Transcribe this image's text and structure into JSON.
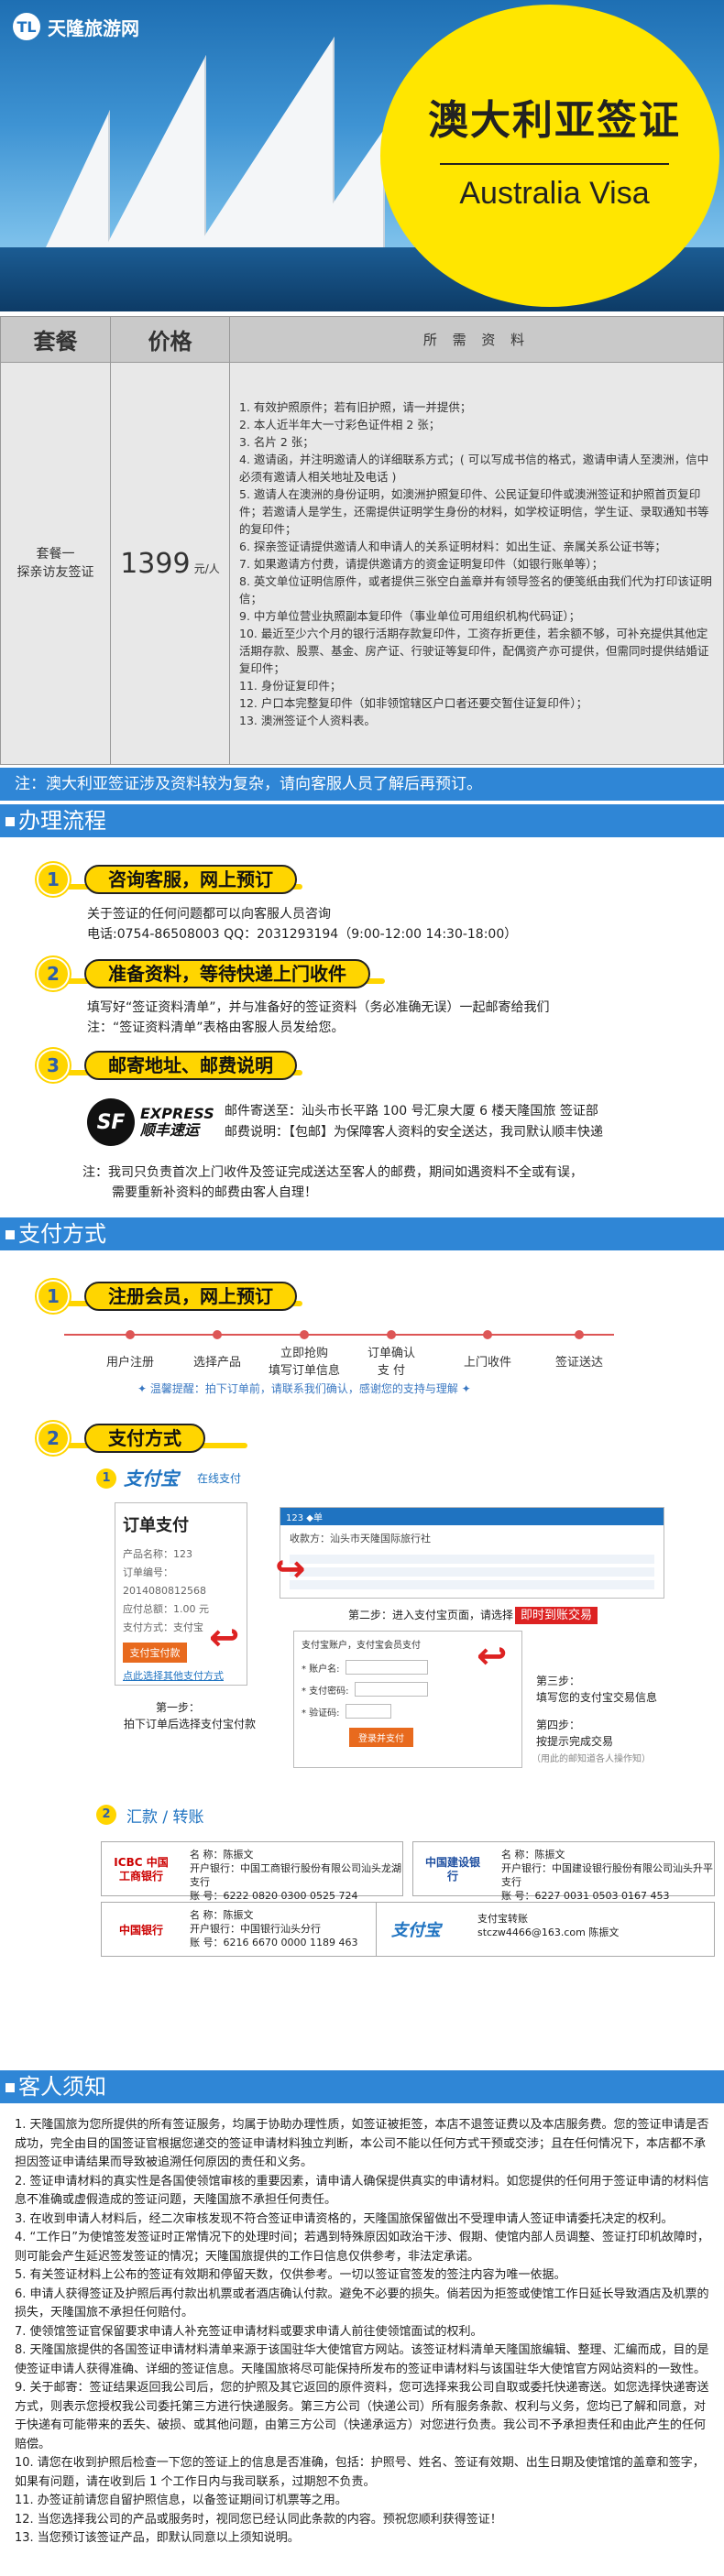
{
  "brand": {
    "name": "天隆旅游网",
    "mark": "TL"
  },
  "hero": {
    "title_cn": "澳大利亚签证",
    "title_en": "Australia Visa"
  },
  "table": {
    "headers": {
      "package": "套餐",
      "price": "价格",
      "requirements": "所 需 资 料"
    },
    "package_name_line1": "套餐一",
    "package_name_line2": "探亲访友签证",
    "price_value": "1399",
    "price_unit": "元/人",
    "requirements": [
      "1. 有效护照原件；若有旧护照，请一并提供；",
      "2. 本人近半年大一寸彩色证件相 2 张；",
      "3. 名片 2 张；",
      "4. 邀请函，并注明邀请人的详细联系方式；( 可以写成书信的格式，邀请申请人至澳洲，信中必须有邀请人相关地址及电话 )",
      "5. 邀请人在澳洲的身份证明，如澳洲护照复印件、公民证复印件或澳洲签证和护照首页复印件；若邀请人是学生，还需提供证明学生身份的材料，如学校证明信，学生证、录取通知书等的复印件；",
      "6. 探亲签证请提供邀请人和申请人的关系证明材料：如出生证、亲属关系公证书等；",
      "7. 如果邀请方付费，请提供邀请方的资金证明复印件（如银行账单等）；",
      "8. 英文单位证明信原件，或者提供三张空白盖章并有领导签名的便笺纸由我们代为打印该证明信；",
      "9. 中方单位营业执照副本复印件（事业单位可用组织机构代码证）；",
      "10. 最近至少六个月的银行活期存款复印件，工资存折更佳，若余额不够，可补充提供其他定活期存款、股票、基金、房产证、行驶证等复印件，配偶资产亦可提供，但需同时提供结婚证复印件；",
      "11. 身份证复印件；",
      "12. 户口本完整复印件（如非领馆辖区户口者还要交暂住证复印件）；",
      "13. 澳洲签证个人资料表。"
    ]
  },
  "note_bar": "注：澳大利亚签证涉及资料较为复杂，请向客服人员了解后再预订。",
  "section_process": {
    "title": "办理流程"
  },
  "process_steps": [
    {
      "num": "1",
      "label": "咨询客服，网上预订"
    },
    {
      "num": "2",
      "label": "准备资料，等待快递上门收件"
    },
    {
      "num": "3",
      "label": "邮寄地址、邮费说明"
    }
  ],
  "process_text": {
    "step1_line1": "关于签证的任何问题都可以向客服人员咨询",
    "step1_line2": "电话:0754-86508003    QQ：2031293194（9:00-12:00  14:30-18:00）",
    "step2_line1": "填写好“签证资料清单”，并与准备好的签证资料（务必准确无误）一起邮寄给我们",
    "step2_line2": "注：“签证资料清单”表格由客服人员发给您。",
    "step3_line1": "邮件寄送至：汕头市长平路 100 号汇泉大厦 6 楼天隆国旅 签证部",
    "step3_line2": "邮费说明：【包邮】为保障客人资料的安全送达，我司默认顺丰快递",
    "note_line1": "注：我司只负责首次上门收件及签证完成送达至客人的邮费，期间如遇资料不全或有误，",
    "note_line2": "需要重新补资料的邮费由客人自理！"
  },
  "sf_logo": {
    "mark": "SF",
    "word1": "EXPRESS",
    "word2": "顺丰速运"
  },
  "section_pay": {
    "title": "支付方式"
  },
  "pay_steps": [
    {
      "num": "1",
      "label": "注册会员，网上预订"
    },
    {
      "num": "2",
      "label": "支付方式"
    }
  ],
  "flow": {
    "steps": [
      "用户注册",
      "选择产品",
      "立即抢购",
      "填写订单信息",
      "订单确认",
      "支 付",
      "上门收件",
      "签证送达"
    ],
    "tip": "✦ 温馨提醒：拍下订单前，请联系我们确认，感谢您的支持与理解 ✦"
  },
  "pay_method": {
    "alipay_num": "1",
    "alipay_logo": "支付宝",
    "alipay_sub": "在线支付",
    "order_title": "订单支付",
    "order_lines": [
      "产品名称：123",
      "订单编号：2014080812568",
      "应付总额：1.00 元",
      "支付方式：支付宝"
    ],
    "pay_button": "支付宝付款",
    "other_link": "点此选择其他支付方式",
    "step1_caption_a": "第一步：",
    "step1_caption_b": "拍下订单后选择支付宝付款",
    "cashier_header": "123 ◆单",
    "cashier_amount": "收款方：汕头市天隆国际旅行社",
    "step2_caption": "第二步：进入支付宝页面，请选择",
    "step2_highlight": "即时到账交易",
    "login_title": "支付宝账户，支付宝会员支付",
    "login_user": "* 账户名:",
    "login_pwd": "* 支付密码:",
    "login_code": "* 验证码:",
    "login_btn": "登录并支付",
    "step3_a": "第三步：",
    "step3_b": "填写您的支付宝交易信息",
    "step4_a": "第四步：",
    "step4_b": "按提示完成交易",
    "step4_c": "（用此的邮知道各人操作知）"
  },
  "remit": {
    "num": "2",
    "title": "汇款 / 转账",
    "banks": [
      {
        "logo": "ICBC 中国工商银行",
        "name": "名    称：陈振文",
        "branch": "开户银行：中国工商银行股份有限公司汕头龙湖支行",
        "acct": "账    号：6222 0820 0300 0525 724"
      },
      {
        "logo": "中国建设银行",
        "name": "名    称：陈振文",
        "branch": "开户银行：中国建设银行股份有限公司汕头升平支行",
        "acct": "账    号：6227 0031 0503 0167 453"
      },
      {
        "logo": "中国银行",
        "name": "名    称：陈振文",
        "branch": "开户银行：中国银行汕头分行",
        "acct": "账    号：6216 6670 0000 1189 463"
      },
      {
        "logo": "支付宝",
        "name": "支付宝转账",
        "branch": "",
        "acct": "stczw4466@163.com  陈振文"
      }
    ]
  },
  "section_notice": {
    "title": "客人须知"
  },
  "notice": [
    "1. 天隆国旅为您所提供的所有签证服务，均属于协助办理性质，如签证被拒签，本店不退签证费以及本店服务费。您的签证申请是否成功，完全由目的国签证官根据您递交的签证申请材料独立判断，本公司不能以任何方式干预或交涉；且在任何情况下，本店都不承担因签证申请结果而导致被追溯任何原因的责任和义务。",
    "2. 签证申请材料的真实性是各国使领馆审核的重要因素，请申请人确保提供真实的申请材料。如您提供的任何用于签证申请的材料信息不准确或虚假造成的签证问题，天隆国旅不承担任何责任。",
    "3. 在收到申请人材料后，经二次审核发现不符合签证申请资格的，天隆国旅保留做出不受理申请人签证申请委托决定的权利。",
    "4. “工作日”为使馆签发签证时正常情况下的处理时间；若遇到特殊原因如政治干涉、假期、使馆内部人员调整、签证打印机故障时，则可能会产生延迟签发签证的情况；天隆国旅提供的工作日信息仅供参考，非法定承诺。",
    "5. 有关签证材料上公布的签证有效期和停留天数，仅供参考。一切以签证官签发的签注内容为唯一依据。",
    "6. 申请人获得签证及护照后再付款出机票或者酒店确认付款。避免不必要的损失。倘若因为拒签或使馆工作日延长导致酒店及机票的损失，天隆国旅不承担任何赔付。",
    "7. 使领馆签证官保留要求申请人补充签证申请材料或要求申请人前往使领馆面试的权利。",
    "8. 天隆国旅提供的各国签证申请材料清单来源于该国驻华大使馆官方网站。该签证材料清单天隆国旅编辑、整理、汇编而成，目的是使签证申请人获得准确、详细的签证信息。天隆国旅将尽可能保持所发布的签证申请材料与该国驻华大使馆官方网站资料的一致性。",
    "9. 关于邮寄：签证结果返回我公司后，您的护照及其它返回的原件资料，您可选择来我公司自取或委托快递寄送。如您选择快递寄送方式，则表示您授权我公司委托第三方进行快递服务。第三方公司（快递公司）所有服务条款、权利与义务，您均已了解和同意，对于快递有可能带来的丢失、破损、或其他问题，由第三方公司（快递承运方）对您进行负责。我公司不予承担责任和由此产生的任何赔偿。",
    "10. 请您在收到护照后检查一下您的签证上的信息是否准确，包括：护照号、姓名、签证有效期、出生日期及使馆馆的盖章和签字，如果有问题，请在收到后 1 个工作日内与我司联系，过期恕不负责。",
    "11. 办签证前请您自留护照信息，以备签证期间订机票等之用。",
    "12. 当您选择我公司的产品或服务时，视同您已经认同此条款的内容。预祝您顺利获得签证！",
    "13. 当您预订该签证产品，即默认同意以上须知说明。"
  ]
}
